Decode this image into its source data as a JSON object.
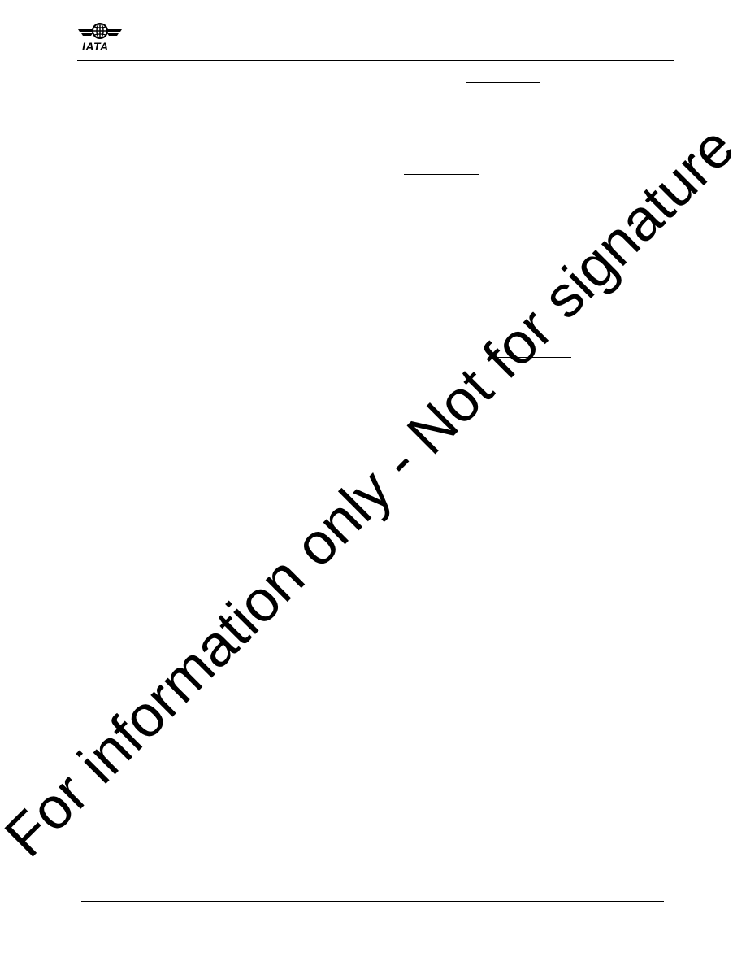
{
  "header": {
    "logo_text": "IATA",
    "logo_icon": "iata-globe-wings-logo"
  },
  "watermark": {
    "text": "For information only - Not for signature"
  },
  "colors": {
    "ink": "#000000",
    "paper": "#ffffff"
  }
}
